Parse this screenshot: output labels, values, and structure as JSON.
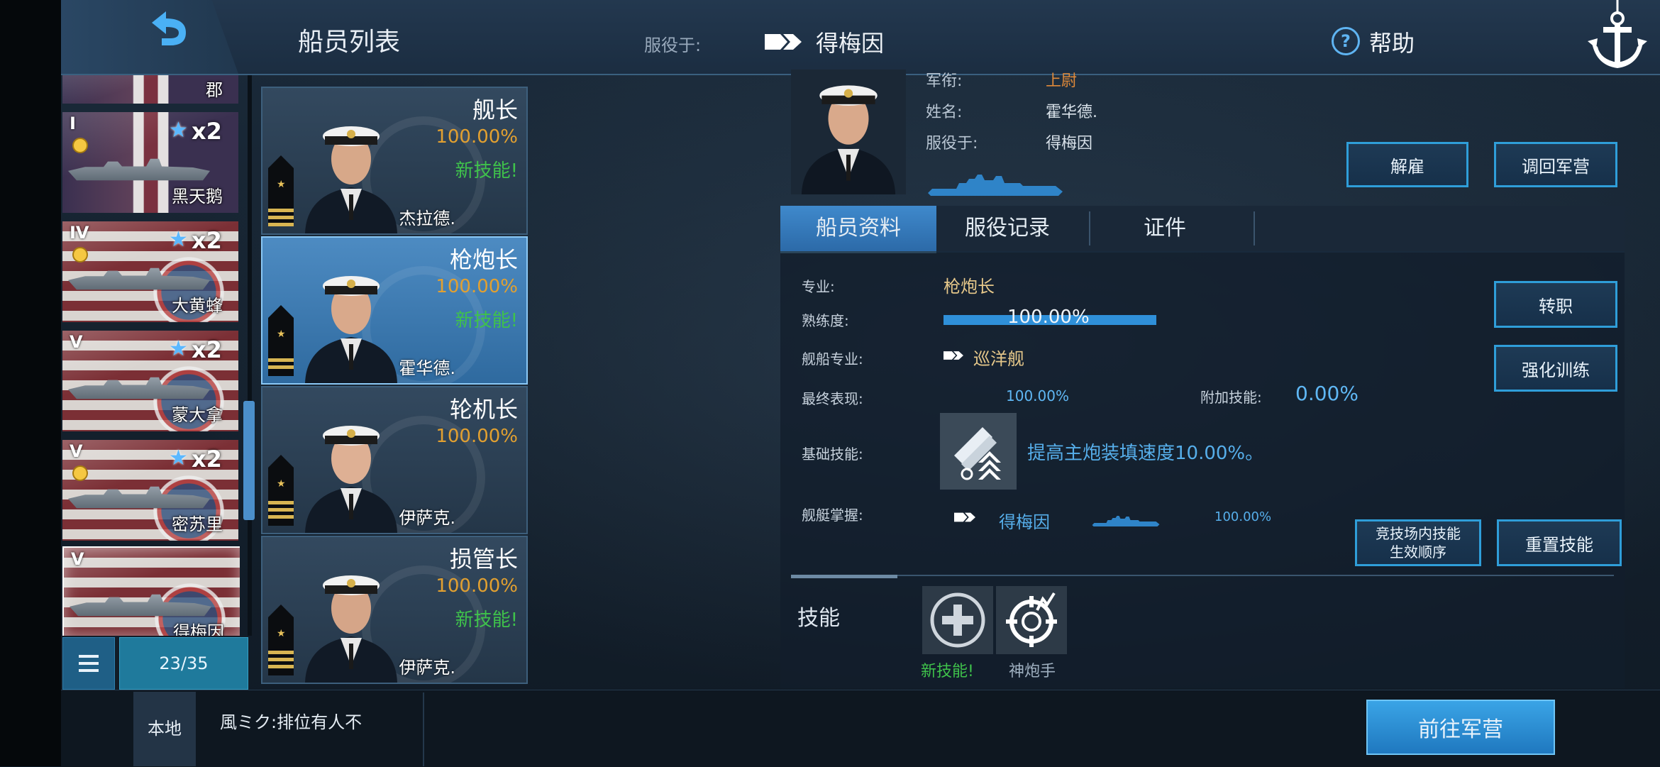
{
  "header": {
    "title": "船员列表",
    "serve_label": "服役于:",
    "serve_ship": "得梅因",
    "help_label": "帮助"
  },
  "ship_list": {
    "items": [
      {
        "name": "郡",
        "tier": "",
        "multiplier": ""
      },
      {
        "name": "黑天鹅",
        "tier": "I",
        "multiplier": "x2"
      },
      {
        "name": "大黄蜂",
        "tier": "IV",
        "multiplier": "x2"
      },
      {
        "name": "蒙大拿",
        "tier": "V",
        "multiplier": "x2"
      },
      {
        "name": "密苏里",
        "tier": "V",
        "multiplier": "x2"
      },
      {
        "name": "得梅因",
        "tier": "V",
        "multiplier": ""
      }
    ],
    "count": "23/35"
  },
  "crew_cards": [
    {
      "role": "舰长",
      "pct": "100.00%",
      "new_skill": "新技能!",
      "name": "杰拉德."
    },
    {
      "role": "枪炮长",
      "pct": "100.00%",
      "new_skill": "新技能!",
      "name": "霍华德."
    },
    {
      "role": "轮机长",
      "pct": "100.00%",
      "new_skill": "",
      "name": "伊萨克."
    },
    {
      "role": "损管长",
      "pct": "100.00%",
      "new_skill": "新技能!",
      "name": "伊萨克."
    }
  ],
  "profile": {
    "rank_label": "军衔:",
    "rank_value": "上尉",
    "name_label": "姓名:",
    "name_value": "霍华德.",
    "serve_label": "服役于:",
    "serve_value": "得梅因"
  },
  "actions": {
    "dismiss": "解雇",
    "recall": "调回军营",
    "transfer": "转职",
    "train": "强化训练",
    "arena_order_line1": "竞技场内技能",
    "arena_order_line2": "生效顺序",
    "reset_skill": "重置技能",
    "go_barracks": "前往军营"
  },
  "tabs": [
    "船员资料",
    "服役记录",
    "证件"
  ],
  "details": {
    "specialty_label": "专业:",
    "specialty_value": "枪炮长",
    "proficiency_label": "熟练度:",
    "proficiency_value": "100.00%",
    "proficiency_fraction": 1.0,
    "ship_specialty_label": "舰船专业:",
    "ship_specialty_value": "巡洋舰",
    "final_perf_label": "最终表现:",
    "final_perf_value": "100.00%",
    "extra_skill_label": "附加技能:",
    "extra_skill_value": "0.00%",
    "base_skill_label": "基础技能:",
    "base_skill_desc": "提高主炮装填速度10.00%。",
    "mastery_label": "舰艇掌握:",
    "mastery_ship": "得梅因",
    "mastery_pct": "100.00%"
  },
  "skills": {
    "label": "技能",
    "slots": [
      {
        "label": "新技能!",
        "icon": "plus-icon"
      },
      {
        "label": "神炮手",
        "icon": "crosshair-icon"
      }
    ]
  },
  "chat": {
    "channel": "本地",
    "message": "風ミク:排位有人不"
  },
  "colors": {
    "accent_blue": "#2f9ed9",
    "rank_orange": "#e08a3a",
    "pct_orange": "#e2a030",
    "new_skill_green": "#3fc24b"
  }
}
